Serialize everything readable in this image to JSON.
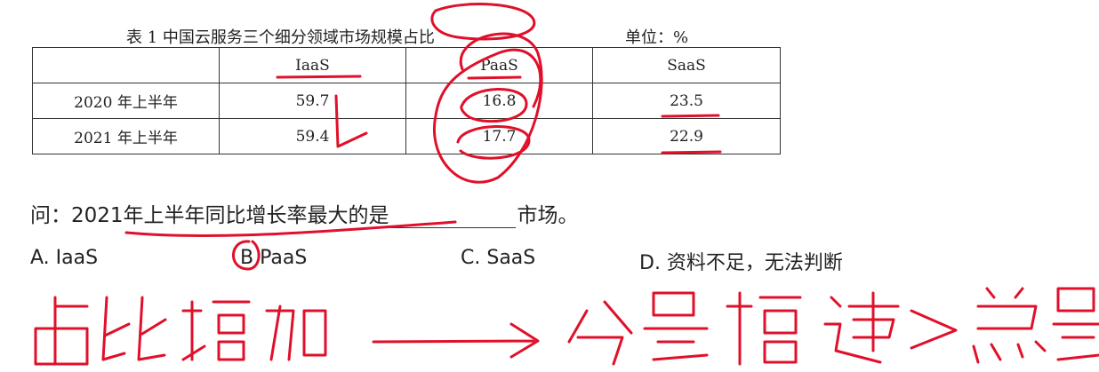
{
  "table": {
    "title": "表 1  中国云服务三个细分领域市场规模占比",
    "unit": "单位：%",
    "headers": [
      "",
      "IaaS",
      "PaaS",
      "SaaS"
    ],
    "rows": [
      [
        "2020 年上半年",
        "59.7",
        "16.8",
        "23.5"
      ],
      [
        "2021 年上半年",
        "59.4",
        "17.7",
        "22.9"
      ]
    ]
  },
  "question": {
    "prefix": "问：2021年上半年同比增长率最大的是",
    "suffix": "市场。"
  },
  "options": [
    {
      "label": "A. IaaS"
    },
    {
      "label": "B PaaS"
    },
    {
      "label": "C. SaaS"
    },
    {
      "label": "D. 资料不足，无法判断"
    }
  ],
  "handwriting": {
    "note": "占比增加 ⟶ 分量增速 > 总量",
    "ink_color": "#e0102a"
  }
}
